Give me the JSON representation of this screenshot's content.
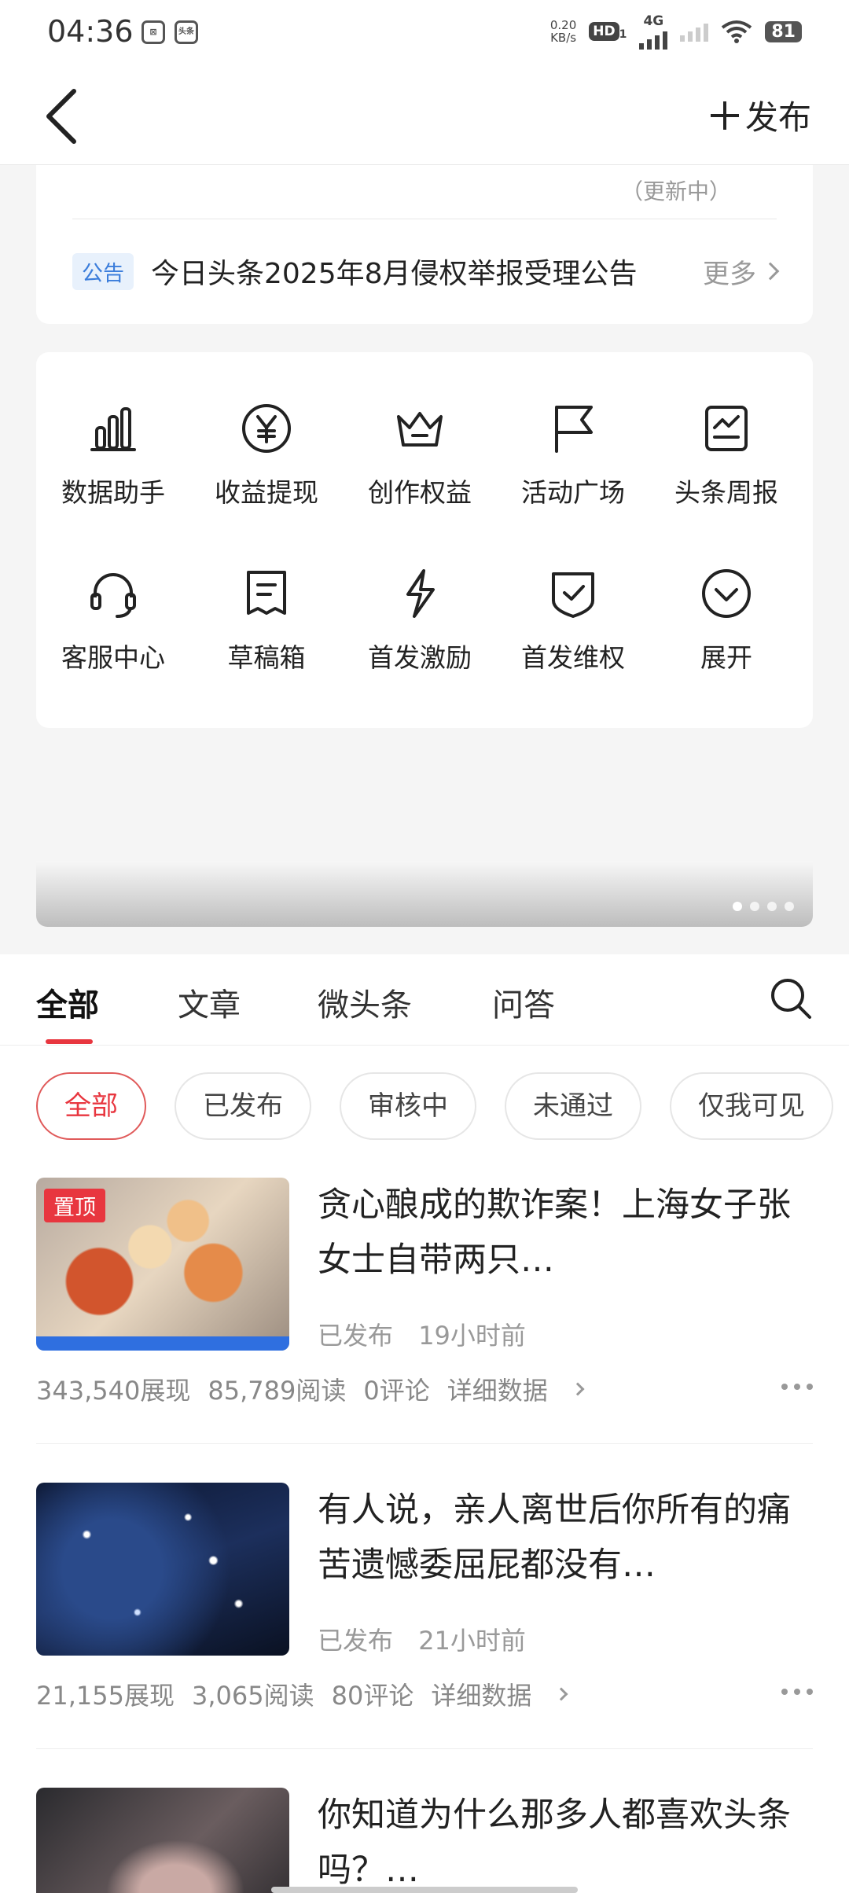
{
  "status_bar": {
    "time": "04:36",
    "net_speed_top": "0.20",
    "net_speed_unit": "KB/s",
    "hd": "HD",
    "sim": "1",
    "network": "4G",
    "battery": "81",
    "notif_icon_1": "⊠",
    "notif_icon_2": "头条"
  },
  "header": {
    "publish_label": "发布"
  },
  "notice": {
    "updating": "（更新中）",
    "tag": "公告",
    "text": "今日头条2025年8月侵权举报受理公告",
    "more": "更多"
  },
  "tools": [
    {
      "label": "数据助手",
      "icon": "bar-chart-icon"
    },
    {
      "label": "收益提现",
      "icon": "yen-icon"
    },
    {
      "label": "创作权益",
      "icon": "crown-icon"
    },
    {
      "label": "活动广场",
      "icon": "flag-icon"
    },
    {
      "label": "头条周报",
      "icon": "report-icon"
    },
    {
      "label": "客服中心",
      "icon": "headset-icon"
    },
    {
      "label": "草稿箱",
      "icon": "draft-icon"
    },
    {
      "label": "首发激励",
      "icon": "lightning-icon"
    },
    {
      "label": "首发维权",
      "icon": "shield-check-icon"
    },
    {
      "label": "展开",
      "icon": "expand-icon"
    }
  ],
  "tabs": [
    "全部",
    "文章",
    "微头条",
    "问答"
  ],
  "filters": [
    "全部",
    "已发布",
    "审核中",
    "未通过",
    "仅我可见"
  ],
  "items": [
    {
      "pinned": "置顶",
      "title": "贪心酿成的欺诈案！上海女子张女士自带两只…",
      "status": "已发布",
      "time": "19小时前",
      "views": "343,540展现",
      "reads": "85,789阅读",
      "comments": "0评论",
      "detail": "详细数据"
    },
    {
      "title": "有人说，亲人离世后你所有的痛苦遗憾委屈屁都没有…",
      "status": "已发布",
      "time": "21小时前",
      "views": "21,155展现",
      "reads": "3,065阅读",
      "comments": "80评论",
      "detail": "详细数据"
    },
    {
      "title": "你知道为什么那多人都喜欢头条吗？…"
    }
  ]
}
